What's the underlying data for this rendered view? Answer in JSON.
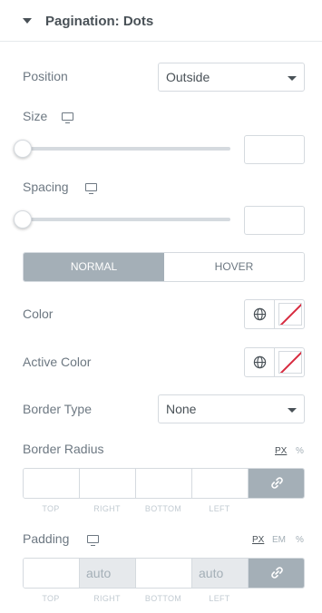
{
  "section": {
    "title": "Pagination: Dots",
    "caret_icon": "caret-down-icon"
  },
  "position": {
    "label": "Position",
    "value": "Outside"
  },
  "size": {
    "label": "Size",
    "device_icon": "desktop-icon",
    "value": "",
    "slider_level": 0
  },
  "spacing": {
    "label": "Spacing",
    "device_icon": "desktop-icon",
    "value": "",
    "slider_level": 0
  },
  "tabs": {
    "normal": "NORMAL",
    "hover": "HOVER",
    "active": "normal"
  },
  "color": {
    "label": "Color",
    "global_icon": "globe-icon",
    "value": "none"
  },
  "active_color": {
    "label": "Active Color",
    "global_icon": "globe-icon",
    "value": "none"
  },
  "border_type": {
    "label": "Border Type",
    "value": "None"
  },
  "border_radius": {
    "label": "Border Radius",
    "units": [
      "PX",
      "%"
    ],
    "active_unit": "PX",
    "fields": [
      {
        "label": "TOP",
        "value": ""
      },
      {
        "label": "RIGHT",
        "value": ""
      },
      {
        "label": "BOTTOM",
        "value": ""
      },
      {
        "label": "LEFT",
        "value": ""
      }
    ],
    "link_icon": "link-icon"
  },
  "padding": {
    "label": "Padding",
    "device_icon": "desktop-icon",
    "units": [
      "PX",
      "EM",
      "%"
    ],
    "active_unit": "PX",
    "fields": [
      {
        "label": "TOP",
        "value": "",
        "placeholder": ""
      },
      {
        "label": "RIGHT",
        "value": "",
        "placeholder": "auto"
      },
      {
        "label": "BOTTOM",
        "value": "",
        "placeholder": ""
      },
      {
        "label": "LEFT",
        "value": "",
        "placeholder": "auto"
      }
    ],
    "link_icon": "link-icon"
  },
  "colors": {
    "tab_active_bg": "#a4afb7",
    "no_color_slash": "#d72b3f",
    "label_text": "#6d7882"
  }
}
